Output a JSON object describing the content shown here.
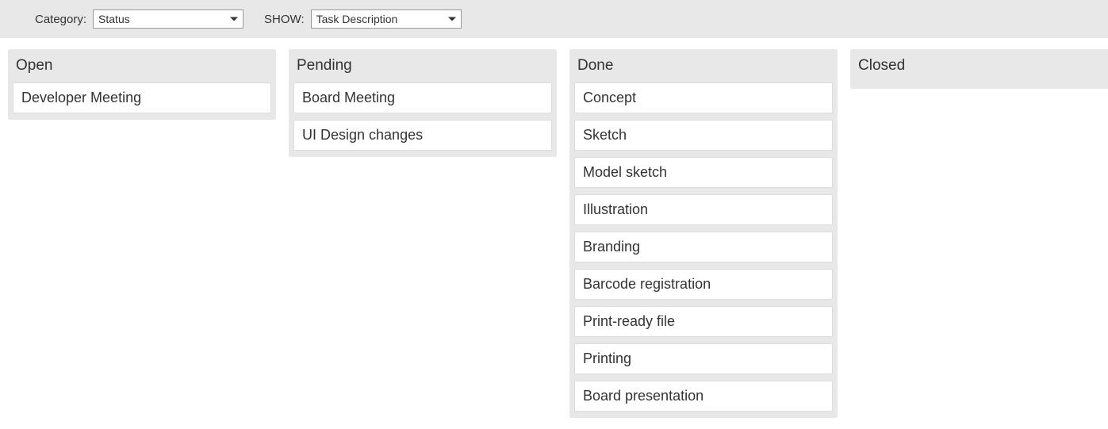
{
  "toolbar": {
    "category_label": "Category:",
    "category_value": "Status",
    "show_label": "SHOW:",
    "show_value": "Task Description"
  },
  "columns": [
    {
      "title": "Open",
      "cards": [
        "Developer Meeting"
      ]
    },
    {
      "title": "Pending",
      "cards": [
        "Board Meeting",
        "UI Design changes"
      ]
    },
    {
      "title": "Done",
      "cards": [
        "Concept",
        "Sketch",
        "Model sketch",
        "Illustration",
        "Branding",
        "Barcode registration",
        "Print-ready file",
        "Printing",
        "Board presentation"
      ]
    },
    {
      "title": "Closed",
      "cards": []
    }
  ]
}
